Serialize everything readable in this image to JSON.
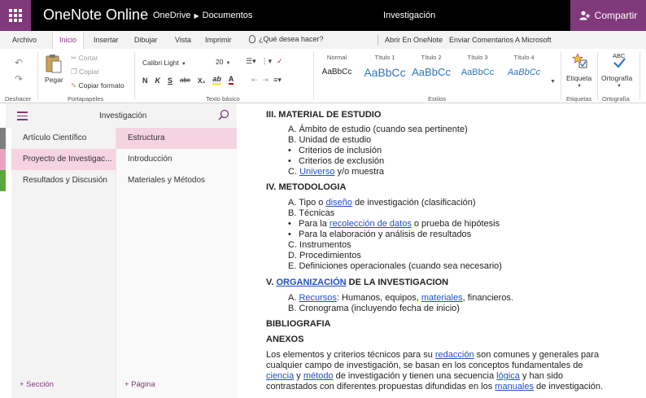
{
  "topbar": {
    "app_name": "OneNote Online",
    "breadcrumb": [
      "OneDrive",
      "Documentos"
    ],
    "notebook_title": "Investigación",
    "share_label": "Compartir"
  },
  "tabs": [
    "Archivo",
    "Inicio",
    "Insertar",
    "Dibujar",
    "Vista",
    "Imprimir"
  ],
  "tell_me": "¿Qué desea hacer?",
  "ribbon_links": [
    "Abrir En OneNote",
    "Enviar Comentarios A Microsoft"
  ],
  "ribbon": {
    "undo_group": "Deshacer",
    "clipboard": {
      "paste": "Pegar",
      "cut": "Cortar",
      "copy": "Copiar",
      "format_painter": "Copiar formato",
      "group": "Portapapeles"
    },
    "font": {
      "name": "Calibri Light",
      "size": "20",
      "group": "Texto básico",
      "buttons": [
        "N",
        "K",
        "S",
        "abc",
        "X₂",
        "ab",
        "A"
      ]
    },
    "styles": {
      "group": "Estilos",
      "items": [
        {
          "name": "Normal",
          "sample": "AaBbCc"
        },
        {
          "name": "Título 1",
          "sample": "AaBbCc"
        },
        {
          "name": "Título 2",
          "sample": "AaBbCc"
        },
        {
          "name": "Título 3",
          "sample": "AaBbCc"
        },
        {
          "name": "Título 4",
          "sample": "AaBbCc"
        }
      ]
    },
    "tags": {
      "label": "Etiqueta",
      "group": "Etiquetas"
    },
    "spelling": {
      "label": "Ortografía",
      "group": "Ortografía",
      "icon_text": "ABC"
    }
  },
  "nav": {
    "notebook": "Investigación",
    "sections": [
      "Artículo Científico",
      "Proyecto de Investigac...",
      "Resultados y Discusión"
    ],
    "pages": [
      "Estructura",
      "Introducción",
      "Materiales y Métodos"
    ],
    "add_section": "+ Sección",
    "add_page": "+ Página"
  },
  "colors": {
    "accent": "#80397b",
    "strip": [
      "#7e7e7e",
      "#e7a3c1",
      "#5aa83a"
    ]
  },
  "doc": {
    "h3": "III. MATERIAL DE ESTUDIO",
    "h3_items": {
      "a": "A. Ámbito de estudio (cuando sea pertinente)",
      "b": "B. Unidad de estudio",
      "b1": "Criterios de inclusión",
      "b2": "Criterios de exclusión",
      "c_pre": "C. ",
      "c_link": "Universo",
      "c_post": " y/o muestra"
    },
    "h4": "IV. METODOLOGIA",
    "h4_items": {
      "a_pre": "A. Tipo o ",
      "a_link": "diseño",
      "a_post": " de investigación (clasificación)",
      "b": "B. Técnicas",
      "b1_pre": "Para la ",
      "b1_link": "recolección de datos",
      "b1_post": " o prueba de hipótesis",
      "b2": "Para la elaboración y análisis de resultados",
      "c": "C. Instrumentos",
      "d": "D. Procedimientos",
      "e": "E. Definiciones operacionales (cuando sea necesario)"
    },
    "h5_pre": "V. ",
    "h5_link": "ORGANIZACIÓN",
    "h5_post": " DE LA INVESTIGACION",
    "h5_items": {
      "a_pre": "A. ",
      "a_link1": "Recursos",
      "a_mid": ": Humanos, equipos, ",
      "a_link2": "materiales",
      "a_post": ", financieros.",
      "b": "B. Cronograma (incluyendo fecha de inicio)"
    },
    "bib": "BIBLIOGRAFIA",
    "annex": "ANEXOS",
    "para": {
      "l1_pre": "Los elementos y criterios técnicos para su ",
      "l1_link": "redacción",
      "l1_post": " son comunes y generales para",
      "l2": "cualquier campo de investigación, se basan en los conceptos fundamentales de",
      "l3_link1": "ciencia",
      "l3_mid1": " y ",
      "l3_link2": "método",
      "l3_mid2": " de investigación y tienen una secuencia ",
      "l3_link3": "lógica",
      "l3_post": " y han sido",
      "l4_pre": "contrastados con diferentes propuestas difundidas en los ",
      "l4_link": "manuales",
      "l4_post": " de investigación."
    }
  }
}
